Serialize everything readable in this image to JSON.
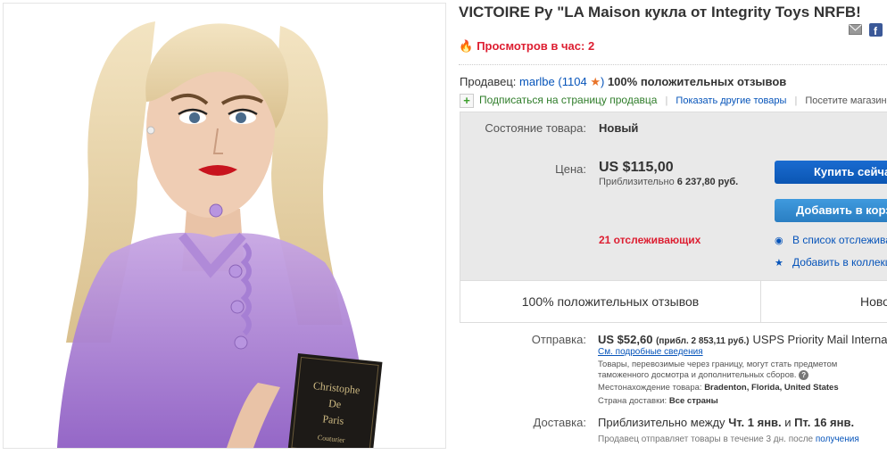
{
  "product": {
    "title": "VICTOIRE Ру \"LA Maison кукла от Integrity Toys NRFB!",
    "views": "Просмотров в час: 2",
    "image_text": "Christophe De Paris Couturier"
  },
  "share": {
    "email_icon": "email-icon",
    "facebook_icon": "facebook-icon"
  },
  "seller": {
    "label": "Продавец:",
    "name": "marlbe",
    "score": "1104",
    "feedback": "100% положительных отзывов",
    "subscribe": "Подписаться на страницу продавца",
    "other_items": "Показать другие товары",
    "visit_store": "Посетите магазин:"
  },
  "item": {
    "condition_label": "Состояние товара:",
    "condition_value": "Новый",
    "price_label": "Цена:",
    "price": "US $115,00",
    "approx_prefix": "Приблизительно",
    "approx_value": "6 237,80 руб.",
    "watchers": "21 отслеживающих",
    "buy_now": "Купить сейчас",
    "add_to_cart": "Добавить в корзину",
    "watchlist": "В список отслеживаемых",
    "collection": "Добавить в коллекцию",
    "promo_feedback": "100% положительных отзывов",
    "promo_new": "Новое"
  },
  "shipping": {
    "label": "Отправка:",
    "price": "US $52,60",
    "approx": "(прибл. 2 853,11 руб.)",
    "service": "USPS Priority Mail International",
    "details": "См. подробные сведения",
    "note": "Товары, перевозимые через границу, могут стать предметом таможенного досмотра и дополнительных сборов.",
    "location_label": "Местонахождение товара:",
    "location": "Bradenton, Florida, United States",
    "dest_label": "Страна доставки:",
    "dest": "Все страны"
  },
  "delivery": {
    "label": "Доставка:",
    "prefix": "Приблизительно между",
    "from": "Чт. 1 янв.",
    "and": "и",
    "to": "Пт. 16 янв.",
    "note": "Продавец отправляет товары в течение 3 дн. после",
    "note_link": "получения"
  },
  "colors": {
    "accent": "#0654ba",
    "alert": "#dd1e31",
    "buy": "#0b56b3"
  }
}
